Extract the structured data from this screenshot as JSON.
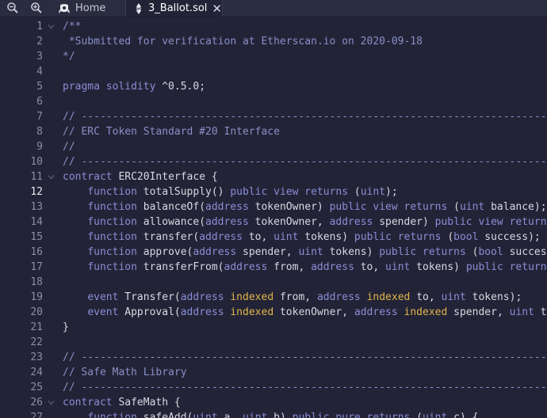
{
  "toolbar": {
    "zoom_out_icon": "magnifier-minus-icon",
    "zoom_in_icon": "magnifier-plus-icon"
  },
  "tabs": [
    {
      "label": "Home",
      "icon": "remix-logo-icon",
      "active": false
    },
    {
      "label": "3_Ballot.sol",
      "icon": "solidity-icon",
      "active": true,
      "close": "close-icon"
    }
  ],
  "editor": {
    "current_line": 12,
    "lines": [
      {
        "n": "1",
        "tokens": [
          {
            "t": "/**",
            "c": "cmt"
          }
        ]
      },
      {
        "n": "2",
        "tokens": [
          {
            "t": " *Submitted for verification at Etherscan.io on 2020-09-18",
            "c": "cmt"
          }
        ]
      },
      {
        "n": "3",
        "tokens": [
          {
            "t": "*/",
            "c": "cmt"
          }
        ]
      },
      {
        "n": "4",
        "tokens": []
      },
      {
        "n": "5",
        "tokens": [
          {
            "t": "pragma solidity",
            "c": "kw"
          },
          {
            "t": " ^0.5.0;",
            "c": "id"
          }
        ]
      },
      {
        "n": "6",
        "tokens": []
      },
      {
        "n": "7",
        "tokens": [
          {
            "t": "// ----------------------------------------------------------------------------",
            "c": "cmt"
          }
        ]
      },
      {
        "n": "8",
        "tokens": [
          {
            "t": "// ERC Token Standard #20 Interface",
            "c": "cmt"
          }
        ]
      },
      {
        "n": "9",
        "tokens": [
          {
            "t": "//",
            "c": "cmt"
          }
        ]
      },
      {
        "n": "10",
        "tokens": [
          {
            "t": "// ----------------------------------------------------------------------------",
            "c": "cmt"
          }
        ]
      },
      {
        "n": "11",
        "tokens": [
          {
            "t": "contract",
            "c": "kw"
          },
          {
            "t": " ERC20Interface {",
            "c": "id"
          }
        ]
      },
      {
        "n": "12",
        "tokens": [
          {
            "t": "    ",
            "c": "id"
          },
          {
            "t": "function",
            "c": "kw"
          },
          {
            "t": " totalSupply() ",
            "c": "id"
          },
          {
            "t": "public view returns",
            "c": "kw"
          },
          {
            "t": " (",
            "c": "id"
          },
          {
            "t": "uint",
            "c": "typ"
          },
          {
            "t": ");",
            "c": "id"
          }
        ]
      },
      {
        "n": "13",
        "tokens": [
          {
            "t": "    ",
            "c": "id"
          },
          {
            "t": "function",
            "c": "kw"
          },
          {
            "t": " balanceOf(",
            "c": "id"
          },
          {
            "t": "address",
            "c": "typ"
          },
          {
            "t": " tokenOwner) ",
            "c": "id"
          },
          {
            "t": "public view returns",
            "c": "kw"
          },
          {
            "t": " (",
            "c": "id"
          },
          {
            "t": "uint",
            "c": "typ"
          },
          {
            "t": " balance);",
            "c": "id"
          }
        ]
      },
      {
        "n": "14",
        "tokens": [
          {
            "t": "    ",
            "c": "id"
          },
          {
            "t": "function",
            "c": "kw"
          },
          {
            "t": " allowance(",
            "c": "id"
          },
          {
            "t": "address",
            "c": "typ"
          },
          {
            "t": " tokenOwner, ",
            "c": "id"
          },
          {
            "t": "address",
            "c": "typ"
          },
          {
            "t": " spender) ",
            "c": "id"
          },
          {
            "t": "public view returns",
            "c": "kw"
          }
        ]
      },
      {
        "n": "15",
        "tokens": [
          {
            "t": "    ",
            "c": "id"
          },
          {
            "t": "function",
            "c": "kw"
          },
          {
            "t": " transfer(",
            "c": "id"
          },
          {
            "t": "address",
            "c": "typ"
          },
          {
            "t": " to, ",
            "c": "id"
          },
          {
            "t": "uint",
            "c": "typ"
          },
          {
            "t": " tokens) ",
            "c": "id"
          },
          {
            "t": "public returns",
            "c": "kw"
          },
          {
            "t": " (",
            "c": "id"
          },
          {
            "t": "bool",
            "c": "typ"
          },
          {
            "t": " success);",
            "c": "id"
          }
        ]
      },
      {
        "n": "16",
        "tokens": [
          {
            "t": "    ",
            "c": "id"
          },
          {
            "t": "function",
            "c": "kw"
          },
          {
            "t": " approve(",
            "c": "id"
          },
          {
            "t": "address",
            "c": "typ"
          },
          {
            "t": " spender, ",
            "c": "id"
          },
          {
            "t": "uint",
            "c": "typ"
          },
          {
            "t": " tokens) ",
            "c": "id"
          },
          {
            "t": "public returns",
            "c": "kw"
          },
          {
            "t": " (",
            "c": "id"
          },
          {
            "t": "bool",
            "c": "typ"
          },
          {
            "t": " success);",
            "c": "id"
          }
        ]
      },
      {
        "n": "17",
        "tokens": [
          {
            "t": "    ",
            "c": "id"
          },
          {
            "t": "function",
            "c": "kw"
          },
          {
            "t": " transferFrom(",
            "c": "id"
          },
          {
            "t": "address",
            "c": "typ"
          },
          {
            "t": " from, ",
            "c": "id"
          },
          {
            "t": "address",
            "c": "typ"
          },
          {
            "t": " to, ",
            "c": "id"
          },
          {
            "t": "uint",
            "c": "typ"
          },
          {
            "t": " tokens) ",
            "c": "id"
          },
          {
            "t": "public returns",
            "c": "kw"
          }
        ]
      },
      {
        "n": "18",
        "tokens": []
      },
      {
        "n": "19",
        "tokens": [
          {
            "t": "    ",
            "c": "id"
          },
          {
            "t": "event",
            "c": "kw"
          },
          {
            "t": " Transfer(",
            "c": "id"
          },
          {
            "t": "address",
            "c": "typ"
          },
          {
            "t": " ",
            "c": "id"
          },
          {
            "t": "indexed",
            "c": "idx"
          },
          {
            "t": " from, ",
            "c": "id"
          },
          {
            "t": "address",
            "c": "typ"
          },
          {
            "t": " ",
            "c": "id"
          },
          {
            "t": "indexed",
            "c": "idx"
          },
          {
            "t": " to, ",
            "c": "id"
          },
          {
            "t": "uint",
            "c": "typ"
          },
          {
            "t": " tokens);",
            "c": "id"
          }
        ]
      },
      {
        "n": "20",
        "tokens": [
          {
            "t": "    ",
            "c": "id"
          },
          {
            "t": "event",
            "c": "kw"
          },
          {
            "t": " Approval(",
            "c": "id"
          },
          {
            "t": "address",
            "c": "typ"
          },
          {
            "t": " ",
            "c": "id"
          },
          {
            "t": "indexed",
            "c": "idx"
          },
          {
            "t": " tokenOwner, ",
            "c": "id"
          },
          {
            "t": "address",
            "c": "typ"
          },
          {
            "t": " ",
            "c": "id"
          },
          {
            "t": "indexed",
            "c": "idx"
          },
          {
            "t": " spender, ",
            "c": "id"
          },
          {
            "t": "uint",
            "c": "typ"
          },
          {
            "t": " tokens);",
            "c": "id"
          }
        ]
      },
      {
        "n": "21",
        "tokens": [
          {
            "t": "}",
            "c": "id"
          }
        ]
      },
      {
        "n": "22",
        "tokens": []
      },
      {
        "n": "23",
        "tokens": [
          {
            "t": "// ----------------------------------------------------------------------------",
            "c": "cmt"
          }
        ]
      },
      {
        "n": "24",
        "tokens": [
          {
            "t": "// Safe Math Library",
            "c": "cmt"
          }
        ]
      },
      {
        "n": "25",
        "tokens": [
          {
            "t": "// ----------------------------------------------------------------------------",
            "c": "cmt"
          }
        ]
      },
      {
        "n": "26",
        "tokens": [
          {
            "t": "contract",
            "c": "kw"
          },
          {
            "t": " SafeMath {",
            "c": "id"
          }
        ]
      },
      {
        "n": "27",
        "tokens": [
          {
            "t": "    ",
            "c": "id"
          },
          {
            "t": "function",
            "c": "kw"
          },
          {
            "t": " safeAdd(",
            "c": "id"
          },
          {
            "t": "uint",
            "c": "typ"
          },
          {
            "t": " a, ",
            "c": "id"
          },
          {
            "t": "uint",
            "c": "typ"
          },
          {
            "t": " b) ",
            "c": "id"
          },
          {
            "t": "public pure returns",
            "c": "kw"
          },
          {
            "t": " (",
            "c": "id"
          },
          {
            "t": "uint",
            "c": "typ"
          },
          {
            "t": " c) {",
            "c": "id"
          }
        ]
      }
    ],
    "folds": [
      "1",
      "11",
      "26"
    ]
  },
  "colors": {
    "background": "#222336",
    "comment": "#8a8fc7",
    "keyword": "#8b8dd6",
    "identifier": "#d8d9e2",
    "indexed": "#e0b44c"
  }
}
